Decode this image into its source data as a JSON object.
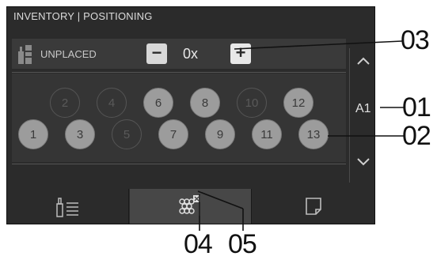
{
  "header": {
    "title": "INVENTORY | POSITIONING"
  },
  "unplaced": {
    "label": "UNPLACED",
    "count": "0x",
    "minus": "−",
    "plus": "+"
  },
  "position": {
    "label": "A1"
  },
  "rack": {
    "top_row": [
      {
        "n": "2",
        "state": "empty"
      },
      {
        "n": "4",
        "state": "empty"
      },
      {
        "n": "6",
        "state": "filled"
      },
      {
        "n": "8",
        "state": "filled"
      },
      {
        "n": "10",
        "state": "empty"
      },
      {
        "n": "12",
        "state": "filled"
      }
    ],
    "bottom_row": [
      {
        "n": "1",
        "state": "filled"
      },
      {
        "n": "3",
        "state": "filled"
      },
      {
        "n": "5",
        "state": "empty"
      },
      {
        "n": "7",
        "state": "filled"
      },
      {
        "n": "9",
        "state": "filled"
      },
      {
        "n": "11",
        "state": "filled"
      },
      {
        "n": "13",
        "state": "filled"
      }
    ]
  },
  "tabs": [
    {
      "icon": "bottle-list-icon"
    },
    {
      "icon": "grape-cluster-icon"
    },
    {
      "icon": "note-icon"
    }
  ],
  "callouts": {
    "c01": "01",
    "c02": "02",
    "c03": "03",
    "c04": "04",
    "c05": "05"
  },
  "colors": {
    "screen_bg": "#2b2b2b",
    "filled": "#9c9c9c",
    "text": "#dcdcdc"
  }
}
